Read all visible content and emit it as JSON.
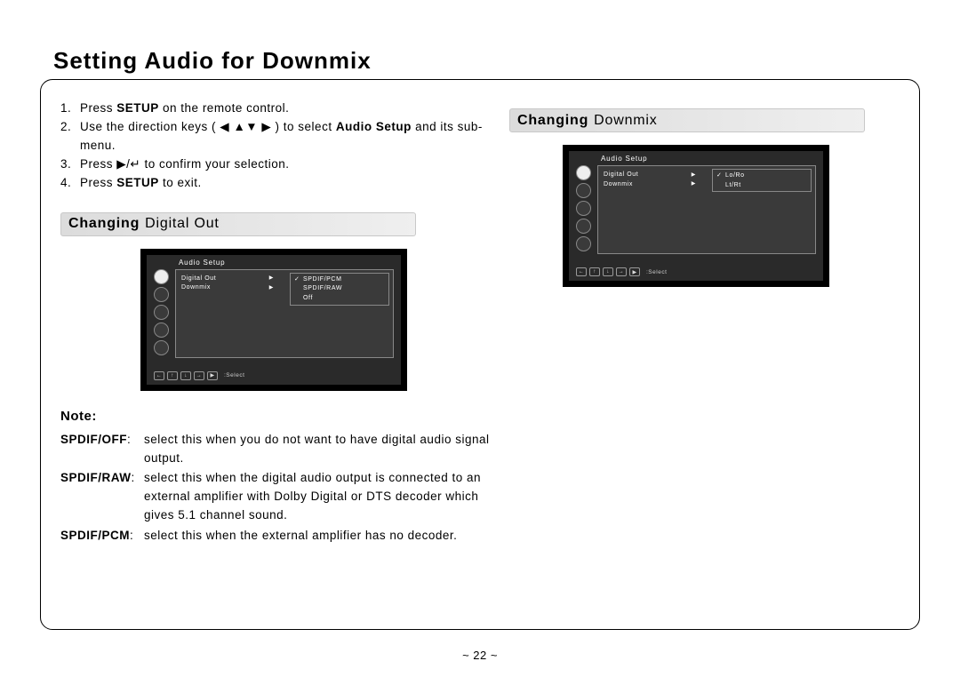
{
  "title": "Setting Audio for Downmix",
  "page_number": "~ 22 ~",
  "steps": [
    {
      "num": "1.",
      "pre": "Press ",
      "bold": "SETUP",
      "post": " on the remote control."
    },
    {
      "num": "2.",
      "pre": "Use the direction keys ( ◀ ▲▼ ▶ ) to select ",
      "bold": "Audio Setup",
      "post": " and its sub-menu."
    },
    {
      "num": "3.",
      "pre": "Press  ▶/↵  to confirm your selection.",
      "bold": "",
      "post": ""
    },
    {
      "num": "4.",
      "pre": "Press ",
      "bold": "SETUP",
      "post": " to exit."
    }
  ],
  "section1": {
    "bold": "Changing",
    "rest": "Digital Out"
  },
  "section2": {
    "bold": "Changing",
    "rest": "Downmix"
  },
  "osd": {
    "title": "Audio Setup",
    "left_items": [
      {
        "label": "Digital Out",
        "arrow": "▶"
      },
      {
        "label": "Downmix",
        "arrow": "▶"
      }
    ],
    "right1": [
      {
        "chk": "✓",
        "label": "SPDIF/PCM"
      },
      {
        "chk": "",
        "label": "SPDIF/RAW"
      },
      {
        "chk": "",
        "label": "Off"
      }
    ],
    "right2": [
      {
        "chk": "✓",
        "label": "Lo/Ro"
      },
      {
        "chk": "",
        "label": "Lt/Rt"
      }
    ],
    "foot_arrows": [
      "←",
      "↑",
      "↓",
      "→"
    ],
    "foot_play": "▶",
    "foot_label": ":Select"
  },
  "note_title": "Note:",
  "notes": [
    {
      "key": "SPDIF/OFF",
      "val": "select this when you do not want to have digital audio signal output."
    },
    {
      "key": "SPDIF/RAW",
      "val": "select this when the digital audio output is connected to an external amplifier with Dolby Digital or DTS decoder which gives 5.1 channel sound."
    },
    {
      "key": "SPDIF/PCM",
      "val": "select this when the external amplifier has no decoder."
    }
  ]
}
